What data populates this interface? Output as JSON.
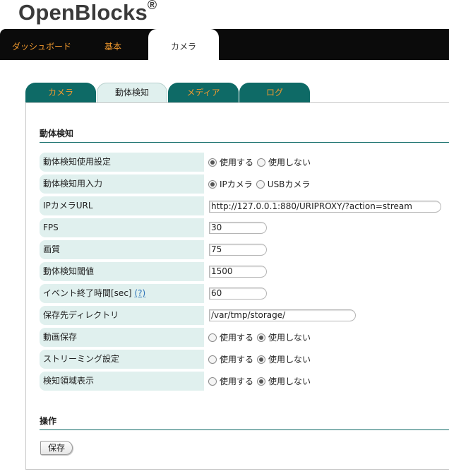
{
  "brand": {
    "name": "OpenBlocks",
    "mark": "®"
  },
  "top_nav": {
    "items": [
      {
        "label": "ダッシュボード"
      },
      {
        "label": "基本"
      },
      {
        "label": "カメラ"
      }
    ],
    "active": "カメラ"
  },
  "sub_tabs": {
    "items": [
      {
        "label": "カメラ"
      },
      {
        "label": "動体検知"
      },
      {
        "label": "メディア"
      },
      {
        "label": "ログ"
      }
    ],
    "active": "動体検知"
  },
  "section_motion": {
    "title": "動体検知"
  },
  "rows": {
    "motion_enable": {
      "label": "動体検知使用設定",
      "options": [
        "使用する",
        "使用しない"
      ],
      "selected": "使用する"
    },
    "motion_input": {
      "label": "動体検知用入力",
      "options": [
        "IPカメラ",
        "USBカメラ"
      ],
      "selected": "IPカメラ"
    },
    "ip_camera_url": {
      "label": "IPカメラURL",
      "value": "http://127.0.0.1:880/URIPROXY/?action=stream"
    },
    "fps": {
      "label": "FPS",
      "value": "30"
    },
    "quality": {
      "label": "画質",
      "value": "75"
    },
    "threshold": {
      "label": "動体検知閾値",
      "value": "1500"
    },
    "event_end": {
      "label": "イベント終了時間[sec]",
      "help": "(?)",
      "value": "60"
    },
    "storage_dir": {
      "label": "保存先ディレクトリ",
      "value": "/var/tmp/storage/"
    },
    "video_save": {
      "label": "動画保存",
      "options": [
        "使用する",
        "使用しない"
      ],
      "selected": "使用しない"
    },
    "streaming": {
      "label": "ストリーミング設定",
      "options": [
        "使用する",
        "使用しない"
      ],
      "selected": "使用しない"
    },
    "area_display": {
      "label": "検知領域表示",
      "options": [
        "使用する",
        "使用しない"
      ],
      "selected": "使用しない"
    }
  },
  "section_ops": {
    "title": "操作"
  },
  "actions": {
    "save_label": "保存"
  },
  "colors": {
    "teal": "#0e6a66",
    "orange": "#f29a2e",
    "label_bg": "#e0f0ee",
    "topbar": "#0b0b0b"
  }
}
